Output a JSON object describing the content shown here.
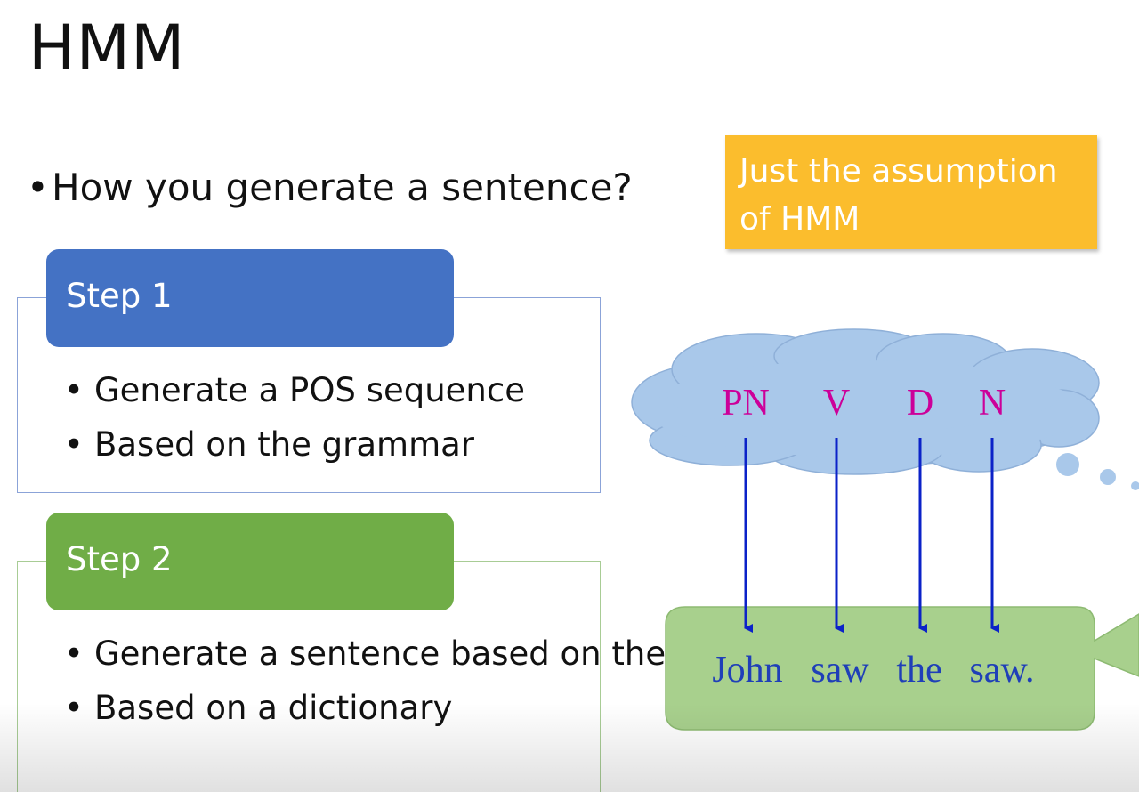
{
  "slide": {
    "title": "HMM",
    "main_bullet": "How you generate a sentence?",
    "note": "Just the assumption of HMM",
    "steps": [
      {
        "label": "Step 1",
        "items": [
          "Generate a POS sequence",
          "Based on the grammar"
        ]
      },
      {
        "label": "Step 2",
        "items": [
          "Generate a sentence based on the POS sequence",
          "Based on a dictionary"
        ]
      }
    ]
  },
  "diagram": {
    "pos_tags": [
      "PN",
      "V",
      "D",
      "N"
    ],
    "words": [
      "John",
      "saw",
      "the",
      "saw."
    ],
    "colors": {
      "cloud": "#a9c8ea",
      "bubble": "#a8d08d",
      "arrow": "#0b22c8",
      "pos_tag": "#cc0099",
      "word": "#1f3fb8"
    }
  },
  "colors": {
    "step1": "#4472c4",
    "step2": "#70ad47",
    "note": "#fbbd2d"
  }
}
